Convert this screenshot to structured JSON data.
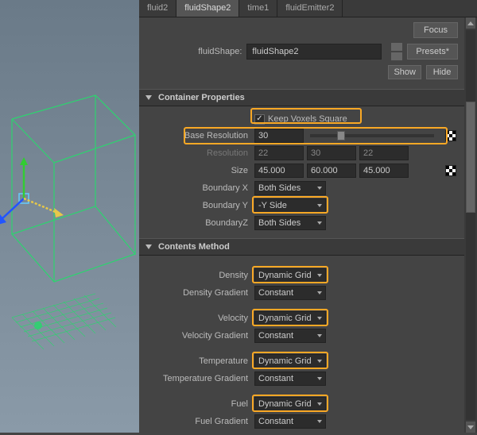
{
  "tabs": [
    "fluid2",
    "fluidShape2",
    "time1",
    "fluidEmitter2"
  ],
  "active_tab_index": 1,
  "header": {
    "focus": "Focus",
    "presets": "Presets*",
    "show": "Show",
    "hide": "Hide",
    "name_label": "fluidShape:",
    "name_value": "fluidShape2"
  },
  "container": {
    "title": "Container Properties",
    "keep_voxels": {
      "label": "Keep Voxels Square",
      "checked": true
    },
    "base_res": {
      "label": "Base Resolution",
      "value": "30",
      "slider_pct": 22
    },
    "resolution": {
      "label": "Resolution",
      "values": [
        "22",
        "30",
        "22"
      ]
    },
    "size": {
      "label": "Size",
      "values": [
        "45.000",
        "60.000",
        "45.000"
      ]
    },
    "boundary_x": {
      "label": "Boundary X",
      "value": "Both Sides"
    },
    "boundary_y": {
      "label": "Boundary Y",
      "value": "-Y Side"
    },
    "boundary_z": {
      "label": "BoundaryZ",
      "value": "Both Sides"
    }
  },
  "contents": {
    "title": "Contents Method",
    "density": {
      "label": "Density",
      "value": "Dynamic Grid"
    },
    "density_grad": {
      "label": "Density Gradient",
      "value": "Constant"
    },
    "velocity": {
      "label": "Velocity",
      "value": "Dynamic Grid"
    },
    "velocity_grad": {
      "label": "Velocity Gradient",
      "value": "Constant"
    },
    "temperature": {
      "label": "Temperature",
      "value": "Dynamic Grid"
    },
    "temperature_grad": {
      "label": "Temperature Gradient",
      "value": "Constant"
    },
    "fuel": {
      "label": "Fuel",
      "value": "Dynamic Grid"
    },
    "fuel_grad": {
      "label": "Fuel Gradient",
      "value": "Constant"
    }
  }
}
